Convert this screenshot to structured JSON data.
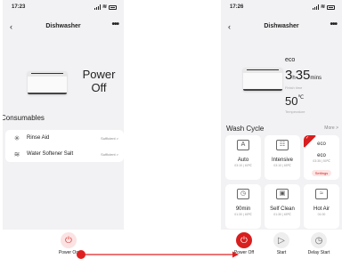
{
  "left": {
    "status_time": "17:23",
    "nav_back": "‹",
    "title": "Dishwasher",
    "more": "•••",
    "power_state": "Power Off",
    "consumables_title": "Consumables",
    "consumables": [
      {
        "icon": "snowflake-icon",
        "glyph": "✳",
        "label": "Rinse Aid",
        "status": "Sufficient >"
      },
      {
        "icon": "salt-icon",
        "glyph": "≋",
        "label": "Water Softener Salt",
        "status": "Sufficient >"
      }
    ],
    "power_button_label": "Power On",
    "power_glyph": "⏻"
  },
  "right": {
    "status_time": "17:26",
    "nav_back": "‹",
    "title": "Dishwasher",
    "more": "•••",
    "program": "eco",
    "hours": "3",
    "hours_unit": "h",
    "mins": "35",
    "mins_unit": "mins",
    "finish_label": "Finish time",
    "temp": "50",
    "temp_unit": "℃",
    "temp_label": "Temperature",
    "wash_cycle_title": "Wash Cycle",
    "more_link": "More >",
    "modes": [
      {
        "icon": "auto-icon",
        "glyph": "A",
        "name": "Auto",
        "detail": "03:10 | 60℃"
      },
      {
        "icon": "intensive-icon",
        "glyph": "☷",
        "name": "Intensive",
        "detail": "03:10 | 65℃"
      },
      {
        "icon": "eco-icon",
        "top": "eco",
        "name": "eco",
        "detail": "03:35 | 50℃",
        "settings": "Settings",
        "selected": true
      },
      {
        "icon": "timer-icon",
        "glyph": "◷",
        "name": "90min",
        "detail": "01:30 | 65℃"
      },
      {
        "icon": "self-clean-icon",
        "glyph": "▣",
        "name": "Self Clean",
        "detail": "01:30 | 65℃"
      },
      {
        "icon": "hot-air-icon",
        "glyph": "≈",
        "name": "Hot Air",
        "detail": "01:00"
      }
    ],
    "controls": [
      {
        "name": "Power Off",
        "glyph": "⏻"
      },
      {
        "name": "Start",
        "glyph": "▷"
      },
      {
        "name": "Delay Start",
        "glyph": "◷"
      }
    ]
  },
  "colors": {
    "accent": "#d81e1e",
    "pink": "#fbe3e3",
    "panel": "#f2f2f4"
  }
}
